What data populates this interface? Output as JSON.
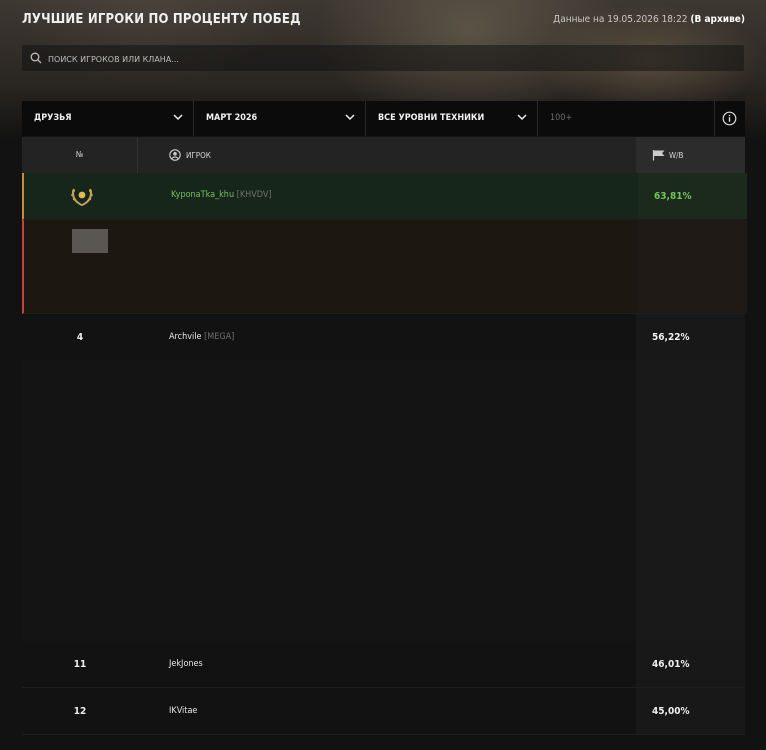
{
  "header": {
    "title": "ЛУЧШИЕ ИГРОКИ ПО ПРОЦЕНТУ ПОБЕД",
    "date_prefix": "Данные на 19.05.2026 18:22",
    "archive_label": "(В архиве)"
  },
  "search": {
    "placeholder": "ПОИСК ИГРОКОВ ИЛИ КЛАНА..."
  },
  "filters": {
    "friends": "ДРУЗЬЯ",
    "period": "МАРТ 2026",
    "tiers": "ВСЕ УРОВНИ ТЕХНИКИ",
    "battles": "100+"
  },
  "table": {
    "col_rank": "№",
    "col_player": "ИГРОК",
    "col_winrate": "W/B"
  },
  "rows": [
    {
      "rank": "",
      "name": "KyponaTka_khu",
      "clan": "[KHVDV]",
      "winrate": "63,81%"
    },
    {
      "rank": "4",
      "name": "Archvile",
      "clan": "[MEGA]",
      "winrate": "56,22%"
    },
    {
      "rank": "11",
      "name": "JekJones",
      "clan": "",
      "winrate": "46,01%"
    },
    {
      "rank": "12",
      "name": "IKVitae",
      "clan": "",
      "winrate": "45,00%"
    }
  ],
  "colors": {
    "highlight": "#74c25a",
    "accent": "#c98a3c",
    "alert": "#c0453a"
  }
}
